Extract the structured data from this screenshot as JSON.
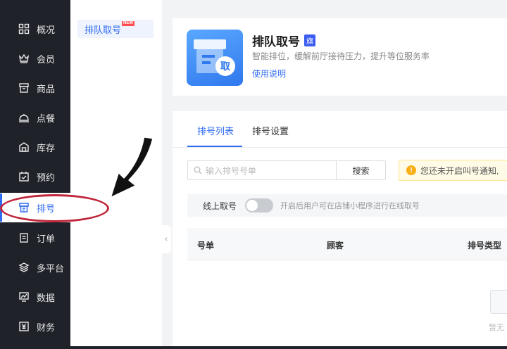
{
  "sidebar": {
    "items": [
      {
        "label": "概况",
        "icon": "grid-icon"
      },
      {
        "label": "会员",
        "icon": "crown-icon"
      },
      {
        "label": "商品",
        "icon": "shop-icon"
      },
      {
        "label": "点餐",
        "icon": "cloche-icon"
      },
      {
        "label": "库存",
        "icon": "warehouse-icon"
      },
      {
        "label": "预约",
        "icon": "calendar-check-icon"
      },
      {
        "label": "排号",
        "icon": "queue-ticket-icon",
        "active": true
      },
      {
        "label": "订单",
        "icon": "order-list-icon"
      },
      {
        "label": "多平台",
        "icon": "layers-icon"
      },
      {
        "label": "数据",
        "icon": "chart-monitor-icon"
      },
      {
        "label": "财务",
        "icon": "yen-icon"
      }
    ]
  },
  "subnav": {
    "item_label": "排队取号",
    "badge": "NEW"
  },
  "header": {
    "app_icon_char": "取",
    "title": "排队取号",
    "flag": "旗",
    "description": "智能排位，缓解前厅接待压力，提升等位服务率",
    "help_link": "使用说明"
  },
  "tabs": [
    {
      "label": "排号列表",
      "active": true
    },
    {
      "label": "排号设置",
      "active": false
    }
  ],
  "search": {
    "placeholder": "输入排号号单",
    "button_label": "搜索"
  },
  "notice": {
    "text": "您还未开启叫号通知,"
  },
  "online": {
    "label": "线上取号",
    "enabled": false,
    "hint": "开启后用户可在店铺小程序进行在线取号"
  },
  "table": {
    "columns": [
      "号单",
      "顾客",
      "排号类型"
    ],
    "empty_text": "暂无"
  },
  "colors": {
    "accent": "#2f6bf0",
    "sidebar_bg": "#1f2229",
    "annotation": "#c0263a"
  }
}
